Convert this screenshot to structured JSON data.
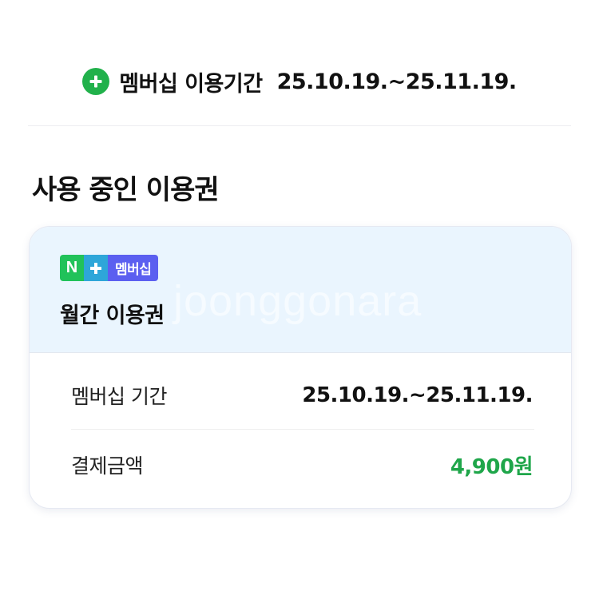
{
  "membership_period": {
    "icon": "plus-circle-icon",
    "icon_color": "#21b14b",
    "label": "멤버십 이용기간",
    "dates": "25.10.19.~25.11.19."
  },
  "active_passes": {
    "title": "사용 중인 이용권",
    "card": {
      "badge": {
        "n": "N",
        "plus_icon": "plus-icon",
        "text": "멤버십",
        "colors": {
          "n": "#21c25a",
          "plus": "#2ea6d9",
          "text": "#5b5ff0"
        }
      },
      "watermark": "joonggonara",
      "plan_name": "월간 이용권",
      "rows": [
        {
          "label": "멤버십 기간",
          "value": "25.10.19.~25.11.19."
        },
        {
          "label": "결제금액",
          "value": "4,900원",
          "value_color": "#1fa64a"
        }
      ]
    }
  }
}
